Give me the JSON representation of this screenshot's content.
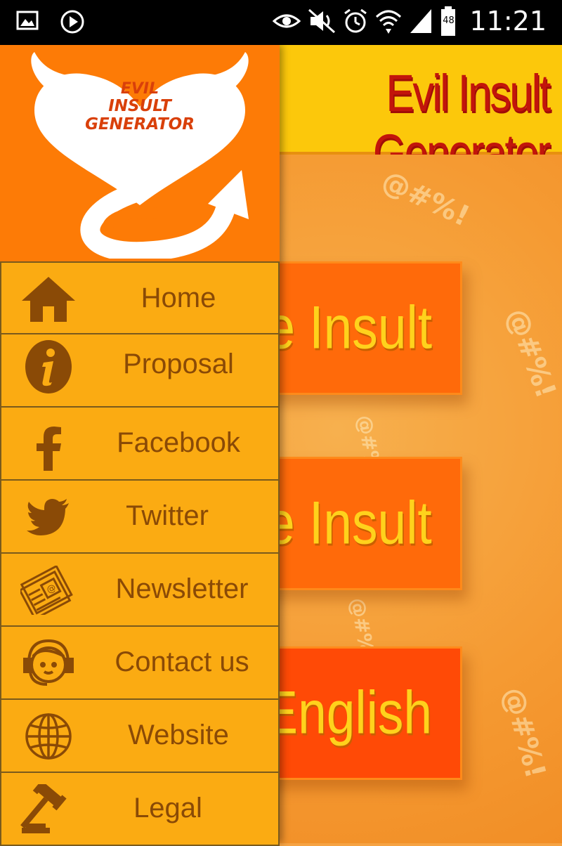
{
  "status_bar": {
    "time": "11:21",
    "battery": "48",
    "icons": [
      "image-icon",
      "play-icon",
      "eye-icon",
      "mute-icon",
      "alarm-icon",
      "wifi-icon",
      "signal-icon",
      "battery-icon"
    ]
  },
  "app_bar": {
    "title": "Evil Insult Generator"
  },
  "main": {
    "buttons": [
      {
        "label": "Generate Insult"
      },
      {
        "label": "Translate Insult"
      },
      {
        "label": "English"
      }
    ],
    "doodle_text": "@#%!"
  },
  "drawer": {
    "logo": {
      "line1": "EVIL",
      "line2": "INSULT",
      "line3": "GENERATOR"
    },
    "items": [
      {
        "label": "Home",
        "icon": "home-icon"
      },
      {
        "label": "Proposal",
        "icon": "info-icon"
      },
      {
        "label": "Facebook",
        "icon": "facebook-icon"
      },
      {
        "label": "Twitter",
        "icon": "twitter-icon"
      },
      {
        "label": "Newsletter",
        "icon": "newsletter-icon"
      },
      {
        "label": "Contact us",
        "icon": "contact-icon"
      },
      {
        "label": "Website",
        "icon": "globe-icon"
      },
      {
        "label": "Legal",
        "icon": "gavel-icon"
      }
    ]
  },
  "colors": {
    "status_bar": "#000000",
    "app_bar": "#fcc80b",
    "title": "#c2150b",
    "drawer_header": "#fd7b06",
    "menu_item": "#fbab12",
    "menu_text": "#8a4a06",
    "button": "#ff6a0a",
    "button_text": "#ffd21c"
  }
}
